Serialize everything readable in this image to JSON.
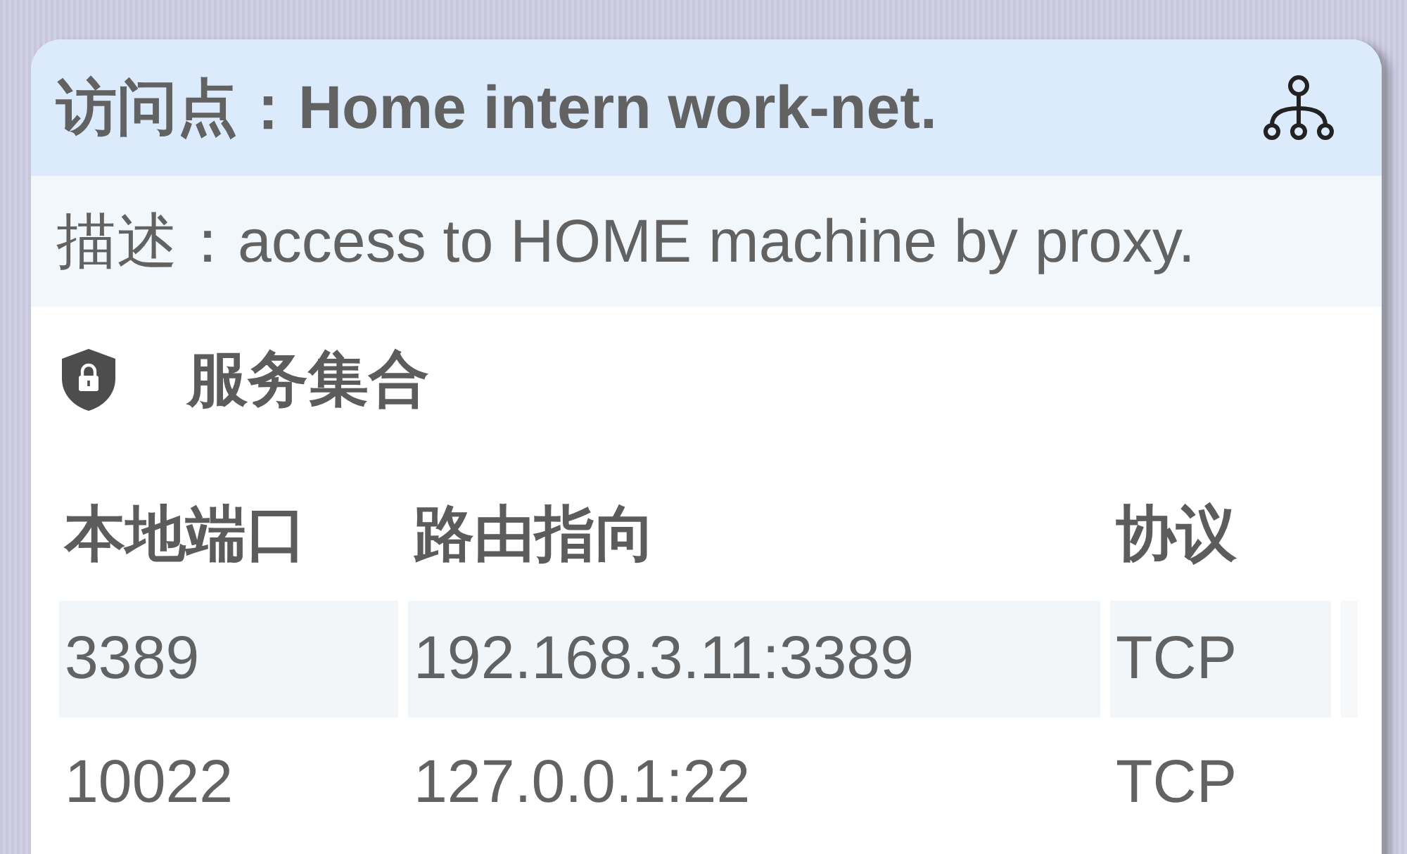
{
  "access_point": {
    "title": "访问点：Home intern work-net."
  },
  "description": "描述：access to HOME machine by proxy.",
  "section": {
    "title": "服务集合"
  },
  "table": {
    "columns": [
      "本地端口",
      "路由指向",
      "协议"
    ],
    "rows": [
      {
        "selected": true,
        "cells": [
          "3389",
          "192.168.3.11:3389",
          "TCP"
        ]
      },
      {
        "selected": false,
        "cells": [
          "10022",
          "127.0.0.1:22",
          "TCP"
        ]
      }
    ]
  }
}
